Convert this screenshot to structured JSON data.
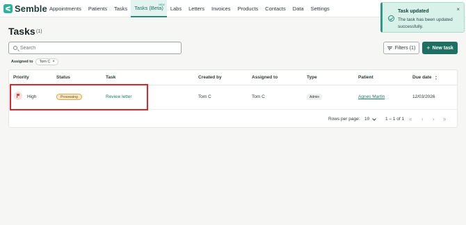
{
  "app": {
    "name": "Semble"
  },
  "nav": {
    "items": [
      {
        "label": "Appointments"
      },
      {
        "label": "Patients"
      },
      {
        "label": "Tasks"
      },
      {
        "label": "Tasks (Beta)",
        "badge": "NEW",
        "active": true
      },
      {
        "label": "Labs"
      },
      {
        "label": "Letters"
      },
      {
        "label": "Invoices"
      },
      {
        "label": "Products"
      },
      {
        "label": "Contacts"
      },
      {
        "label": "Data"
      },
      {
        "label": "Settings"
      }
    ]
  },
  "toast": {
    "title": "Task updated",
    "message": "The task has been updated successfully.",
    "close": "×",
    "icon": "check-circle-icon"
  },
  "page": {
    "title": "Tasks",
    "count": "(1)"
  },
  "search": {
    "placeholder": "Search",
    "value": ""
  },
  "toolbar": {
    "filters_label": "Filters (1)",
    "new_task_label": "New task",
    "new_task_plus": "+"
  },
  "active_filter": {
    "label": "Assigned to",
    "value": "Tom C",
    "remove": "×"
  },
  "table": {
    "columns": [
      "Priority",
      "Status",
      "Task",
      "Created by",
      "Assigned to",
      "Type",
      "Patient",
      "Due date"
    ],
    "rows": [
      {
        "priority": "High",
        "status": "Processing",
        "task": "Review letter",
        "created_by": "Tom C",
        "assigned_to": "Tom C",
        "type": "Admin",
        "patient": "Agnes Martin",
        "due_date": "12/03/2026"
      }
    ]
  },
  "pagination": {
    "rows_per_page_label": "Rows per page:",
    "rows_per_page": "10",
    "range": "1 – 1 of 1",
    "first": "«",
    "prev": "‹",
    "next": "›",
    "last": "»"
  },
  "colors": {
    "brand": "#2bb39b",
    "primary_button": "#1f6f62",
    "highlight": "#e2232a",
    "status_processing": "#fde9c9",
    "priority_high": "#d14b3c"
  }
}
